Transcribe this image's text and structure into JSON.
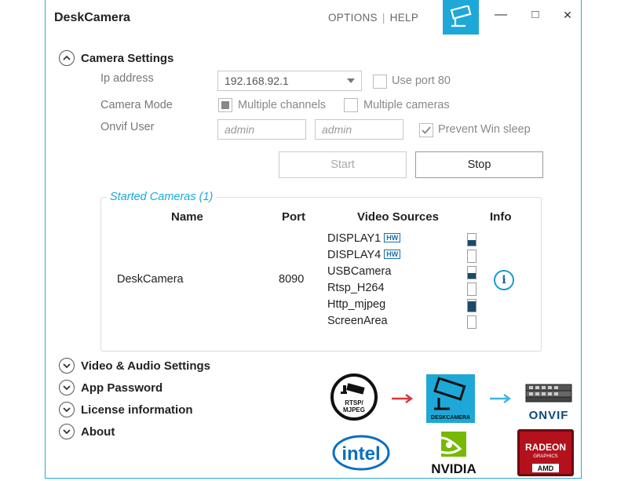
{
  "app": {
    "title": "DeskCamera"
  },
  "topmenu": {
    "options": "OPTIONS",
    "separator": "|",
    "help": "HELP"
  },
  "window": {
    "minimize": "—",
    "maximize": "□",
    "close": "✕"
  },
  "camera_settings": {
    "title": "Camera Settings",
    "ip_label": "Ip address",
    "ip_value": "192.168.92.1",
    "use_port_label": "Use port 80",
    "use_port_checked": false,
    "mode_label": "Camera Mode",
    "multiple_channels_label": "Multiple channels",
    "multiple_channels_checked": true,
    "multiple_cameras_label": "Multiple cameras",
    "multiple_cameras_checked": false,
    "onvif_label": "Onvif User",
    "onvif_user_placeholder": "admin",
    "onvif_pass_placeholder": "admin",
    "prevent_sleep_label": "Prevent Win sleep",
    "prevent_sleep_checked": true,
    "start_label": "Start",
    "stop_label": "Stop"
  },
  "started_cameras": {
    "title": "Started Cameras (1)",
    "columns": {
      "name": "Name",
      "port": "Port",
      "sources": "Video Sources",
      "info": "Info"
    },
    "row": {
      "name": "DeskCamera",
      "port": "8090",
      "sources": [
        {
          "name": "DISPLAY1",
          "hw": "HW",
          "level": 0.45
        },
        {
          "name": "DISPLAY4",
          "hw": "HW",
          "level": 0.0
        },
        {
          "name": "USBCamera",
          "hw": "",
          "level": 0.45
        },
        {
          "name": "Rtsp_H264",
          "hw": "",
          "level": 0.0
        },
        {
          "name": "Http_mjpeg",
          "hw": "",
          "level": 0.9
        },
        {
          "name": "ScreenArea",
          "hw": "",
          "level": 0.0
        }
      ],
      "info_icon": "i"
    }
  },
  "sections": {
    "video_audio": "Video & Audio Settings",
    "app_password": "App Password",
    "license": "License information",
    "about": "About"
  },
  "logos": {
    "rtsp_line1": "RTSP/",
    "rtsp_line2": "MJPEG",
    "deskcamera": "DESKCAMERA",
    "onvif": "ONVIF",
    "intel": "intel",
    "nvidia": "NVIDIA",
    "radeon": "RADEON",
    "radeon_sub": "GRAPHICS",
    "amd": "AMD"
  },
  "colors": {
    "accent": "#1ea8d8",
    "arrow_red": "#d9383a",
    "arrow_blue": "#3fb5e8",
    "nvidia_green": "#76b900",
    "intel_blue": "#0a6fc2",
    "radeon_red": "#b3121c"
  }
}
